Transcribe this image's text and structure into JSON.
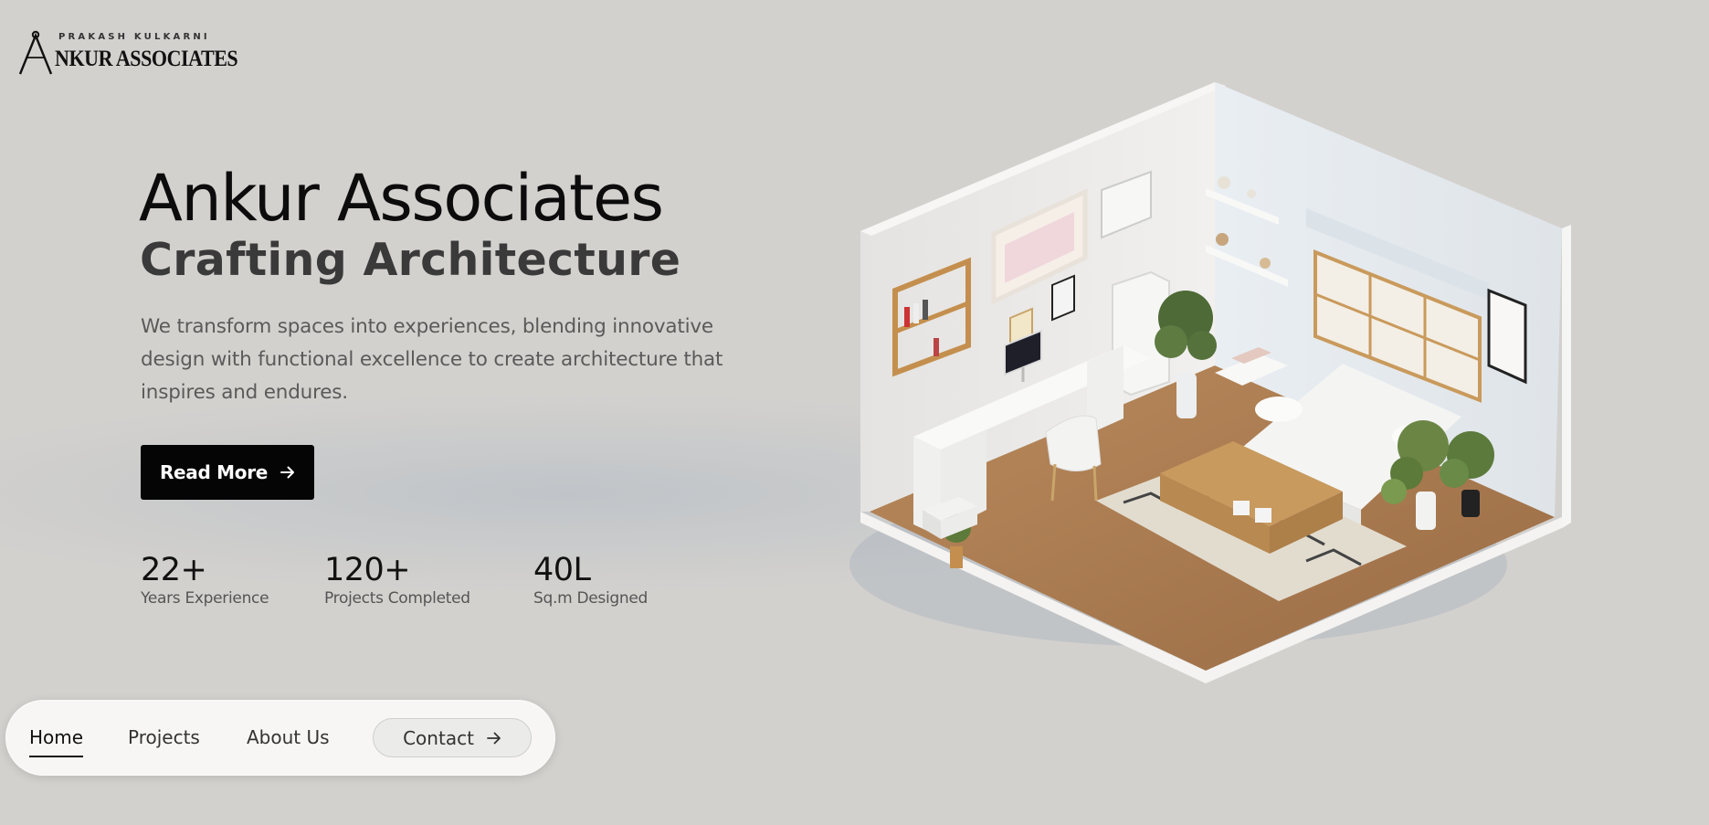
{
  "brand": {
    "subtitle": "PRAKASH KULKARNI",
    "name": "NKUR ASSOCIATES",
    "logo_icon": "compass-a-icon"
  },
  "hero": {
    "title": "Ankur Associates",
    "subtitle": "Crafting Architecture",
    "description": "We transform spaces into experiences, blending innovative design with functional excellence to create architecture that inspires and endures.",
    "cta_label": "Read More",
    "cta_icon": "arrow-right-icon"
  },
  "stats": [
    {
      "value": "22+",
      "label": "Years Experience"
    },
    {
      "value": "120+",
      "label": "Projects Completed"
    },
    {
      "value": "40L",
      "label": "Sq.m Designed"
    }
  ],
  "nav": {
    "items": [
      {
        "label": "Home",
        "active": true
      },
      {
        "label": "Projects",
        "active": false
      },
      {
        "label": "About Us",
        "active": false
      }
    ],
    "contact_label": "Contact",
    "contact_icon": "arrow-right-icon"
  },
  "colors": {
    "background": "#d3d1ce",
    "primary_button": "#050505",
    "nav_background": "#f7f6f5",
    "text_dark": "#0c0c0c",
    "text_muted": "#5a5a5a"
  },
  "illustration": {
    "subject": "isometric-room-icon"
  }
}
